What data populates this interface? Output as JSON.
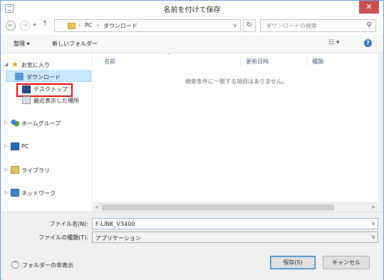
{
  "window": {
    "title": "名前を付けて保存",
    "close_glyph": "✕"
  },
  "nav": {
    "back_glyph": "←",
    "forward_glyph": "→",
    "dropdown_glyph": "▾",
    "up_glyph": "↑",
    "breadcrumb": [
      "PC",
      "ダウンロード"
    ],
    "breadcrumb_sep": "›",
    "address_dropdown_glyph": "∨",
    "refresh_glyph": "↻",
    "search_placeholder": "ダウンロードの検索",
    "search_glyph": "⚲"
  },
  "toolbar": {
    "organize_label": "整理 ▾",
    "new_folder_label": "新しいフォルダー",
    "view_glyph": "☷ ▾",
    "help_glyph": "?"
  },
  "sidebar": {
    "favorites_label": "お気に入り",
    "favorites_items": [
      {
        "label": "ダウンロード",
        "icon": "download-folder-icon",
        "selected": true
      },
      {
        "label": "デスクトップ",
        "icon": "desktop-icon",
        "highlighted": true
      },
      {
        "label": "最近表示した場所",
        "icon": "recent-places-icon"
      }
    ],
    "homegroup_label": "ホームグループ",
    "pc_label": "PC",
    "libraries_label": "ライブラリ",
    "network_label": "ネットワーク",
    "expand_glyph": "▷",
    "collapse_glyph": "◢"
  },
  "file_list": {
    "columns": [
      "名前",
      "更新日時",
      "種類"
    ],
    "sort_glyph": "^",
    "empty_message": "検索条件に一致する項目はありません。"
  },
  "scrollbar": {
    "left_glyph": "<",
    "right_glyph": ">"
  },
  "form": {
    "filename_label": "ファイル名(N):",
    "filename_value": "F-LINK_V3400",
    "filetype_label": "ファイルの種類(T):",
    "filetype_value": "アプリケーション",
    "dropdown_glyph": "∨",
    "hide_folders_label": "フォルダーの非表示",
    "hide_folders_glyph": "^",
    "save_label": "保存(S)",
    "cancel_label": "キャンセル"
  }
}
